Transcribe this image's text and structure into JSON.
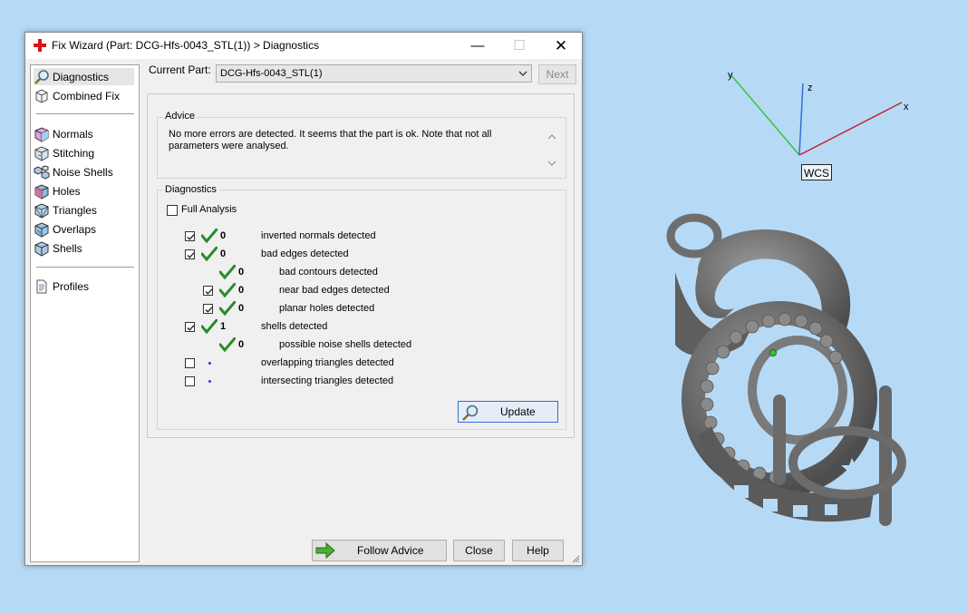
{
  "window": {
    "title": "Fix Wizard (Part: DCG-Hfs-0043_STL(1)) > Diagnostics",
    "minimize_glyph": "—",
    "maximize_glyph": "☐",
    "close_glyph": "✕"
  },
  "sidebar": {
    "items": [
      {
        "label": "Diagnostics",
        "icon": "magnifier-icon",
        "selected": true
      },
      {
        "label": "Combined Fix",
        "icon": "cube-outline-icon"
      },
      {
        "label": "Normals",
        "icon": "cube-normals-icon"
      },
      {
        "label": "Stitching",
        "icon": "cube-stitching-icon"
      },
      {
        "label": "Noise Shells",
        "icon": "noise-shells-icon"
      },
      {
        "label": "Holes",
        "icon": "cube-holes-icon"
      },
      {
        "label": "Triangles",
        "icon": "cube-triangles-icon"
      },
      {
        "label": "Overlaps",
        "icon": "cube-overlaps-icon"
      },
      {
        "label": "Shells",
        "icon": "cube-shells-icon"
      },
      {
        "label": "Profiles",
        "icon": "document-icon"
      }
    ]
  },
  "current_part": {
    "label": "Current Part:",
    "value": "DCG-Hfs-0043_STL(1)"
  },
  "next_button": "Next",
  "advice": {
    "title": "Advice",
    "text": "No more errors are detected. It seems that the part is ok. Note that not all parameters were analysed."
  },
  "diagnostics": {
    "title": "Diagnostics",
    "full_analysis": {
      "label": "Full Analysis",
      "checked": false
    },
    "rows": [
      {
        "checked": true,
        "status": "ok",
        "count": "0",
        "label": "inverted normals detected"
      },
      {
        "checked": true,
        "status": "ok",
        "count": "0",
        "label": "bad edges detected"
      },
      {
        "status": "ok",
        "count": "0",
        "label": "bad contours detected"
      },
      {
        "checked": true,
        "status": "ok",
        "count": "0",
        "label": "near bad edges detected"
      },
      {
        "checked": true,
        "status": "ok",
        "count": "0",
        "label": "planar holes detected"
      },
      {
        "checked": true,
        "status": "ok",
        "count": "1",
        "label": "shells detected"
      },
      {
        "status": "ok",
        "count": "0",
        "label": "possible noise shells detected"
      },
      {
        "checked": false,
        "status": "not-run",
        "count": "",
        "label": "overlapping triangles detected"
      },
      {
        "checked": false,
        "status": "not-run",
        "count": "",
        "label": "intersecting triangles detected"
      }
    ],
    "update_button": "Update"
  },
  "footer": {
    "follow_advice": "Follow Advice",
    "close": "Close",
    "help": "Help"
  },
  "viewport": {
    "axes": {
      "x": "x",
      "y": "y",
      "z": "z"
    },
    "wcs_label": "WCS",
    "colors": {
      "x_axis": "#c8232c",
      "y_axis": "#37c637",
      "z_axis": "#2f6fd6",
      "background": "#b6daf6",
      "model": "#6e6e6e"
    }
  }
}
